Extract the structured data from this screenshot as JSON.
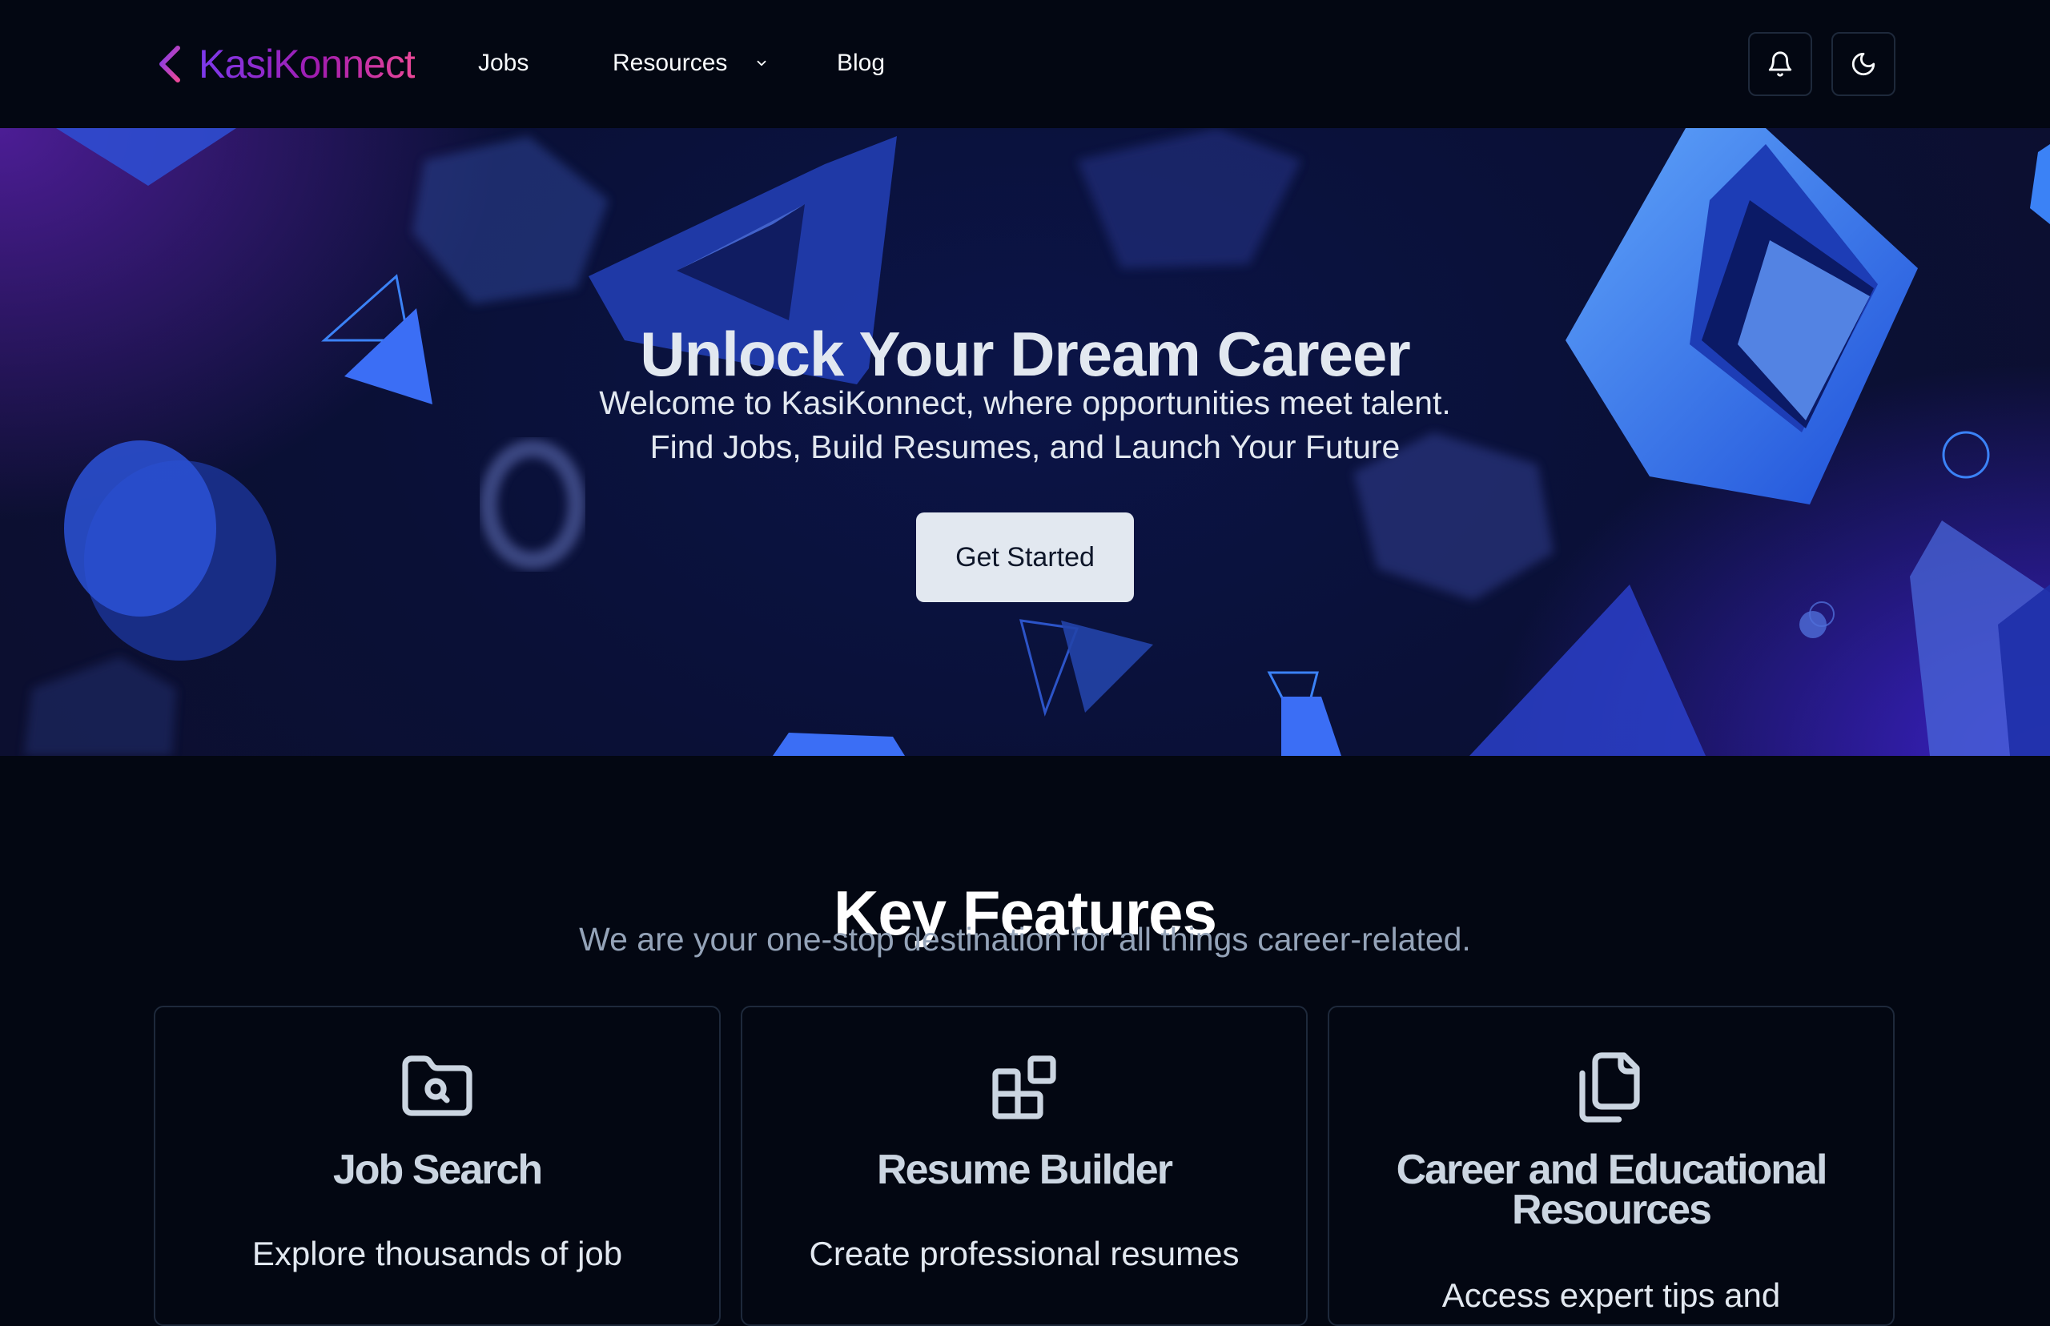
{
  "brand": {
    "name": "KasiKonnect",
    "logo_icon": "k-logo-icon"
  },
  "nav": {
    "jobs": "Jobs",
    "resources": "Resources",
    "blog": "Blog"
  },
  "header_actions": {
    "notifications_icon": "bell-icon",
    "theme_icon": "moon-icon"
  },
  "hero": {
    "title": "Unlock Your Dream Career",
    "subtitle_line1": "Welcome to KasiKonnect, where opportunities meet talent.",
    "subtitle_line2": "Find Jobs, Build Resumes, and Launch Your Future",
    "cta_label": "Get Started"
  },
  "features": {
    "title": "Key Features",
    "subtitle": "We are your one-stop destination for all things career-related.",
    "cards": [
      {
        "icon": "folder-search-icon",
        "title": "Job Search",
        "text": "Explore thousands of job"
      },
      {
        "icon": "blocks-icon",
        "title": "Resume Builder",
        "text": "Create professional resumes"
      },
      {
        "icon": "files-icon",
        "title": "Career and Educational Resources",
        "text": "Access expert tips and"
      }
    ]
  },
  "colors": {
    "background": "#030712",
    "brand_gradient_start": "#7c3aed",
    "brand_gradient_end": "#ec4899",
    "hero_accent": "#3b82f6",
    "muted_text": "#94a3b8"
  }
}
